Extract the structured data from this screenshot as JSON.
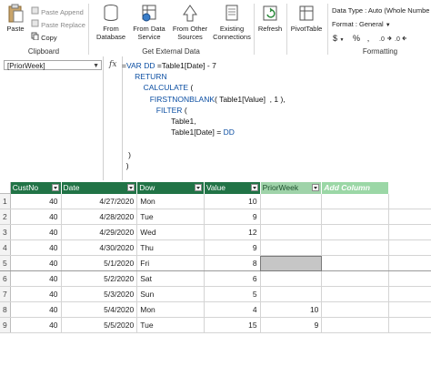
{
  "ribbon": {
    "clipboard": {
      "paste_label": "Paste",
      "paste_append_label": "Paste Append",
      "paste_replace_label": "Paste Replace",
      "copy_label": "Copy",
      "group_label": "Clipboard"
    },
    "external": {
      "from_database_label": "From\nDatabase",
      "from_data_service_label": "From Data\nService",
      "from_other_sources_label": "From Other\nSources",
      "existing_connections_label": "Existing\nConnections",
      "group_label": "Get External Data"
    },
    "refresh_label": "Refresh",
    "pivottable_label": "PivotTable",
    "formatting": {
      "data_type": "Data Type : Auto (Whole Numbe",
      "format": "Format : General",
      "currency_symbol": "$",
      "percent_symbol": "%",
      "comma_symbol": " , ",
      "group_label": "Formatting"
    }
  },
  "formula_bar": {
    "name_box": "[PriorWeek]",
    "fx": "fx"
  },
  "table": {
    "columns": [
      "CustNo",
      "Date",
      "Dow",
      "Value",
      "PriorWeek",
      "Add Column"
    ],
    "rows": [
      {
        "n": "1",
        "custno": "40",
        "date": "4/27/2020",
        "dow": "Mon",
        "value": "10",
        "prior": ""
      },
      {
        "n": "2",
        "custno": "40",
        "date": "4/28/2020",
        "dow": "Tue",
        "value": "9",
        "prior": ""
      },
      {
        "n": "3",
        "custno": "40",
        "date": "4/29/2020",
        "dow": "Wed",
        "value": "12",
        "prior": ""
      },
      {
        "n": "4",
        "custno": "40",
        "date": "4/30/2020",
        "dow": "Thu",
        "value": "9",
        "prior": ""
      },
      {
        "n": "5",
        "custno": "40",
        "date": "5/1/2020",
        "dow": "Fri",
        "value": "8",
        "prior": ""
      },
      {
        "n": "6",
        "custno": "40",
        "date": "5/2/2020",
        "dow": "Sat",
        "value": "6",
        "prior": ""
      },
      {
        "n": "7",
        "custno": "40",
        "date": "5/3/2020",
        "dow": "Sun",
        "value": "5",
        "prior": ""
      },
      {
        "n": "8",
        "custno": "40",
        "date": "5/4/2020",
        "dow": "Mon",
        "value": "4",
        "prior": "10"
      },
      {
        "n": "9",
        "custno": "40",
        "date": "5/5/2020",
        "dow": "Tue",
        "value": "15",
        "prior": "9"
      }
    ]
  },
  "colors": {
    "header_green": "#217346",
    "add_column_green": "#9bd7a6",
    "keyword_blue": "#0b4ea2"
  }
}
